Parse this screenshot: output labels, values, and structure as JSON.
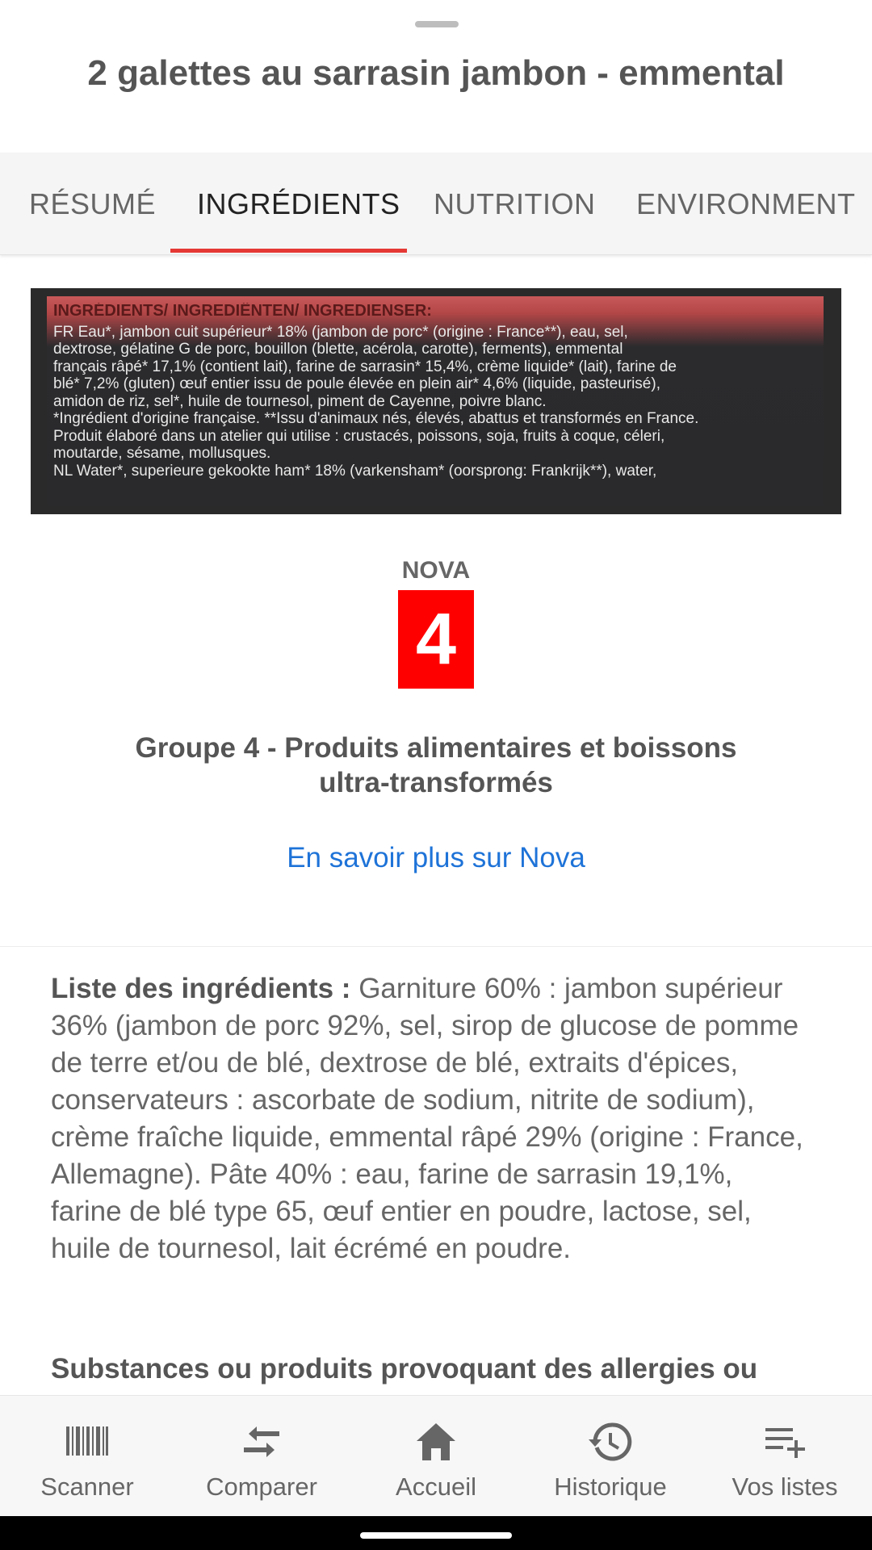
{
  "product": {
    "title": "2 galettes au sarrasin jambon - emmental"
  },
  "tabs": [
    {
      "label": "RÉSUMÉ",
      "active": false
    },
    {
      "label": "INGRÉDIENTS",
      "active": true
    },
    {
      "label": "NUTRITION",
      "active": false
    },
    {
      "label": "ENVIRONMENT",
      "active": false
    }
  ],
  "label_photo": {
    "lines": [
      "INGRÉDIENTS/ INGREDIËNTEN/ INGREDIENSER:",
      "FR Eau*, jambon cuit supérieur* 18% (jambon de porc* (origine : France**), eau, sel,",
      "dextrose, gélatine G de porc, bouillon (blette, acérola, carotte), ferments), emmental",
      "français râpé* 17,1% (contient lait), farine de sarrasin* 15,4%, crème liquide* (lait), farine de",
      "blé* 7,2% (gluten) œuf entier issu de poule élevée en plein air* 4,6% (liquide, pasteurisé),",
      "amidon de riz, sel*, huile de tournesol, piment de Cayenne, poivre blanc.",
      "*Ingrédient d'origine française. **Issu d'animaux nés, élevés, abattus et transformés en France.",
      "Produit élaboré dans un atelier qui utilise : crustacés, poissons, soja, fruits à coque, céleri,",
      "moutarde, sésame, mollusques.",
      "NL Water*, superieure gekookte ham* 18% (varkensham* (oorsprong: Frankrijk**), water,"
    ]
  },
  "nova": {
    "label": "NOVA",
    "group": "4",
    "description": "Groupe 4 - Produits alimentaires et boissons ultra-transformés",
    "link": "En savoir plus sur Nova",
    "color": "#ff0000"
  },
  "ingredients": {
    "heading": "Liste des ingrédients :",
    "text": " Garniture 60% : jambon supérieur 36% (jambon de porc 92%, sel, sirop de glucose de pomme de terre et/ou de blé, dextrose de blé, extraits d'épices, conservateurs : ascorbate de sodium, nitrite de sodium), crème fraîche liquide, emmental râpé 29% (origine : France, Allemagne). Pâte 40% : eau, farine de sarrasin 19,1%, farine de blé type 65, œuf entier en poudre, lactose, sel, huile de tournesol, lait écrémé en poudre."
  },
  "allergens": {
    "heading": "Substances ou produits provoquant des allergies ou"
  },
  "bottom_nav": [
    {
      "label": "Scanner",
      "icon": "barcode-icon"
    },
    {
      "label": "Comparer",
      "icon": "compare-icon"
    },
    {
      "label": "Accueil",
      "icon": "home-icon"
    },
    {
      "label": "Historique",
      "icon": "history-icon"
    },
    {
      "label": "Vos listes",
      "icon": "playlist-add-icon"
    }
  ],
  "colors": {
    "accent": "#e53935",
    "link": "#1e73d8"
  }
}
